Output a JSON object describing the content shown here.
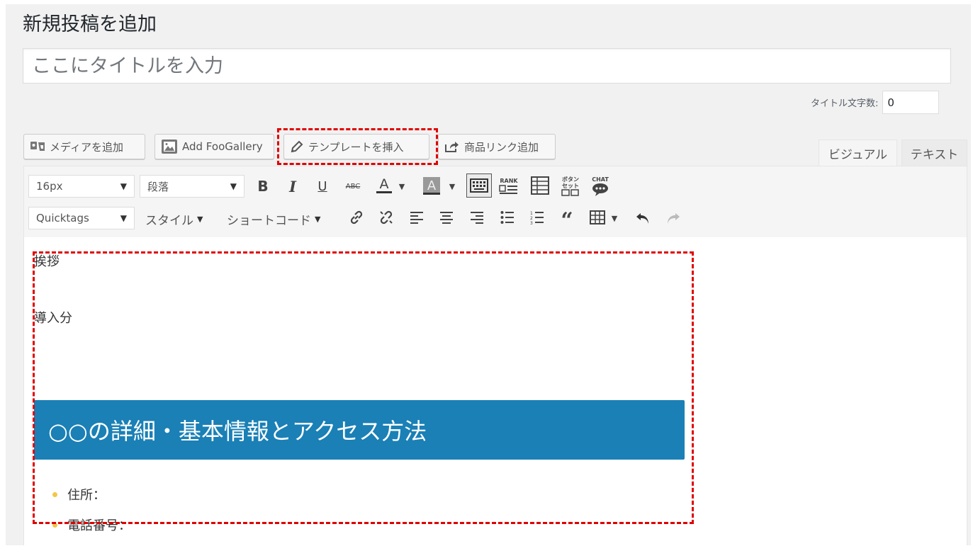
{
  "page": {
    "title": "新規投稿を追加",
    "title_placeholder": "ここにタイトルを入力",
    "title_count_label": "タイトル文字数:",
    "title_count_value": "0"
  },
  "media_buttons": [
    {
      "label": "メディアを追加",
      "icon": "media-icon"
    },
    {
      "label": "Add FooGallery",
      "icon": "gallery-icon"
    },
    {
      "label": "テンプレートを挿入",
      "icon": "pencil-icon"
    },
    {
      "label": "商品リンク追加",
      "icon": "share-icon"
    }
  ],
  "tabs": {
    "visual": "ビジュアル",
    "text": "テキスト"
  },
  "toolbar": {
    "font_size": "16px",
    "format": "段落",
    "quicktags": "Quicktags",
    "style_menu": "スタイル",
    "shortcode_menu": "ショートコード",
    "rank_icon_label": "RANK",
    "chat_icon_label": "CHAT",
    "button_icon_label": "ボタン セット"
  },
  "content": {
    "para1": "挨拶",
    "para2": "導入分",
    "heading": "○○の詳細・基本情報とアクセス方法",
    "list": [
      "住所：",
      "電話番号："
    ]
  },
  "colors": {
    "heading_bg": "#1a80b6",
    "highlight": "#e00000",
    "bullet": "#f3c647"
  }
}
